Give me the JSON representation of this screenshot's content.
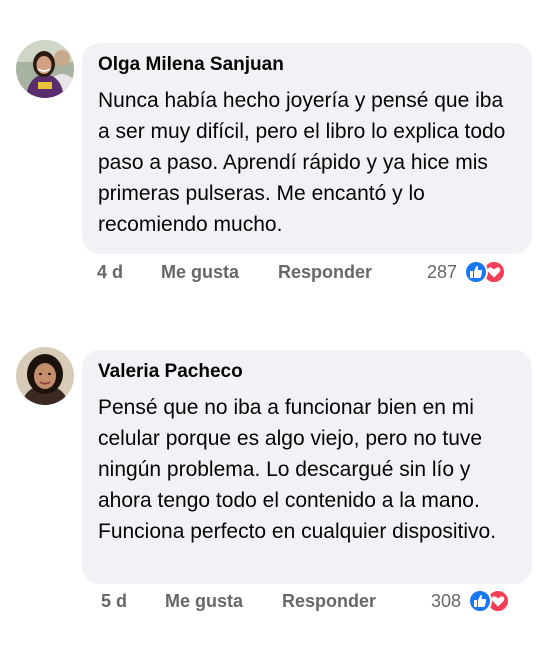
{
  "comments": [
    {
      "author": "Olga Milena Sanjuan",
      "text": "Nunca había hecho joyería y pensé que iba a ser muy difícil, pero el libro lo explica todo paso a paso. Aprendí rápido y ya hice mis primeras pulseras. Me encantó y lo recomiendo mucho.",
      "time": "4 d",
      "like_label": "Me gusta",
      "reply_label": "Responder",
      "reaction_count": "287",
      "reactions": [
        "like-icon",
        "love-icon"
      ]
    },
    {
      "author": "Valeria Pacheco",
      "text": "Pensé que no iba a funcionar bien en mi celular porque es algo viejo, pero no tuve ningún problema. Lo descargué sin lío y ahora tengo todo el contenido a la mano. Funciona perfecto en cualquier dispositivo.",
      "time": "5 d",
      "like_label": "Me gusta",
      "reply_label": "Responder",
      "reaction_count": "308",
      "reactions": [
        "like-icon",
        "love-icon"
      ]
    }
  ],
  "colors": {
    "bubble": "#f0f2f5",
    "meta_text": "#65676b",
    "like_blue": "#1877f2",
    "love_red": "#f33e58"
  }
}
